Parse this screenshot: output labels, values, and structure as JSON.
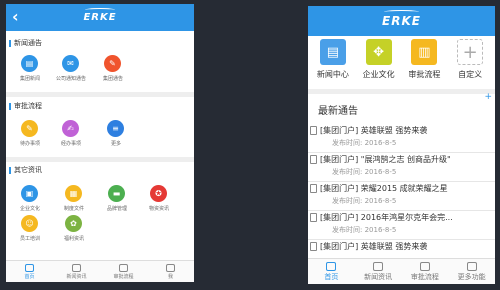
{
  "brand": "ERKE",
  "left_phone": {
    "back_glyph": "‹",
    "sections": [
      {
        "title": "新闻通告",
        "items": [
          {
            "label": "集团新闻",
            "icon": "news-icon",
            "color": "#2e95e6"
          },
          {
            "label": "公司通知通告",
            "icon": "notice-icon",
            "color": "#2e95e6"
          },
          {
            "label": "集团通告",
            "icon": "megaphone-icon",
            "color": "#f0542d"
          }
        ]
      },
      {
        "title": "审批流程",
        "items": [
          {
            "label": "待办事项",
            "icon": "edit-icon",
            "color": "#f5b820"
          },
          {
            "label": "经办事项",
            "icon": "pen-icon",
            "color": "#c062d6"
          },
          {
            "label": "更多",
            "icon": "menu-icon",
            "color": "#2e7fe0"
          }
        ]
      },
      {
        "title": "其它资讯",
        "items": [
          {
            "label": "企业文化",
            "icon": "book-icon",
            "color": "#2e95e6"
          },
          {
            "label": "制度文件",
            "icon": "grid-icon",
            "color": "#f5b820"
          },
          {
            "label": "品牌管理",
            "icon": "briefcase-icon",
            "color": "#4caf50"
          },
          {
            "label": "物资资讯",
            "icon": "award-icon",
            "color": "#e53935"
          },
          {
            "label": "员工培训",
            "icon": "people-icon",
            "color": "#f5b820"
          },
          {
            "label": "福利资讯",
            "icon": "flower-icon",
            "color": "#7cb342"
          }
        ]
      }
    ],
    "tabs": [
      "首页",
      "新闻资讯",
      "审批流程",
      "我"
    ]
  },
  "right_phone": {
    "shortcuts": [
      {
        "label": "新闻中心",
        "icon": "newspaper-icon",
        "color": "#4a9fe8"
      },
      {
        "label": "企业文化",
        "icon": "puzzle-icon",
        "color": "#c5d127"
      },
      {
        "label": "审批流程",
        "icon": "document-icon",
        "color": "#f5b820"
      },
      {
        "label": "自定义",
        "icon": "plus-icon",
        "color": "#ffffff"
      }
    ],
    "plus_mark": "+",
    "news_heading": "最新通告",
    "time_prefix": "发布时间:",
    "news": [
      {
        "title": "[集团门户] 英雄联盟 强势来袭",
        "time": "2016-8-5"
      },
      {
        "title": "[集团门户] \"展鸿鹄之志 创商品升级\"",
        "time": "2016-8-5"
      },
      {
        "title": "[集团门户] 荣耀2015 成就荣耀之星",
        "time": "2016-8-5"
      },
      {
        "title": "[集团门户] 2016年鸿星尔克年会完...",
        "time": "2016-8-5"
      },
      {
        "title": "[集团门户] 英雄联盟 强势来袭",
        "time": ""
      }
    ],
    "tabs": [
      "首页",
      "新闻资讯",
      "审批流程",
      "更多功能"
    ]
  }
}
